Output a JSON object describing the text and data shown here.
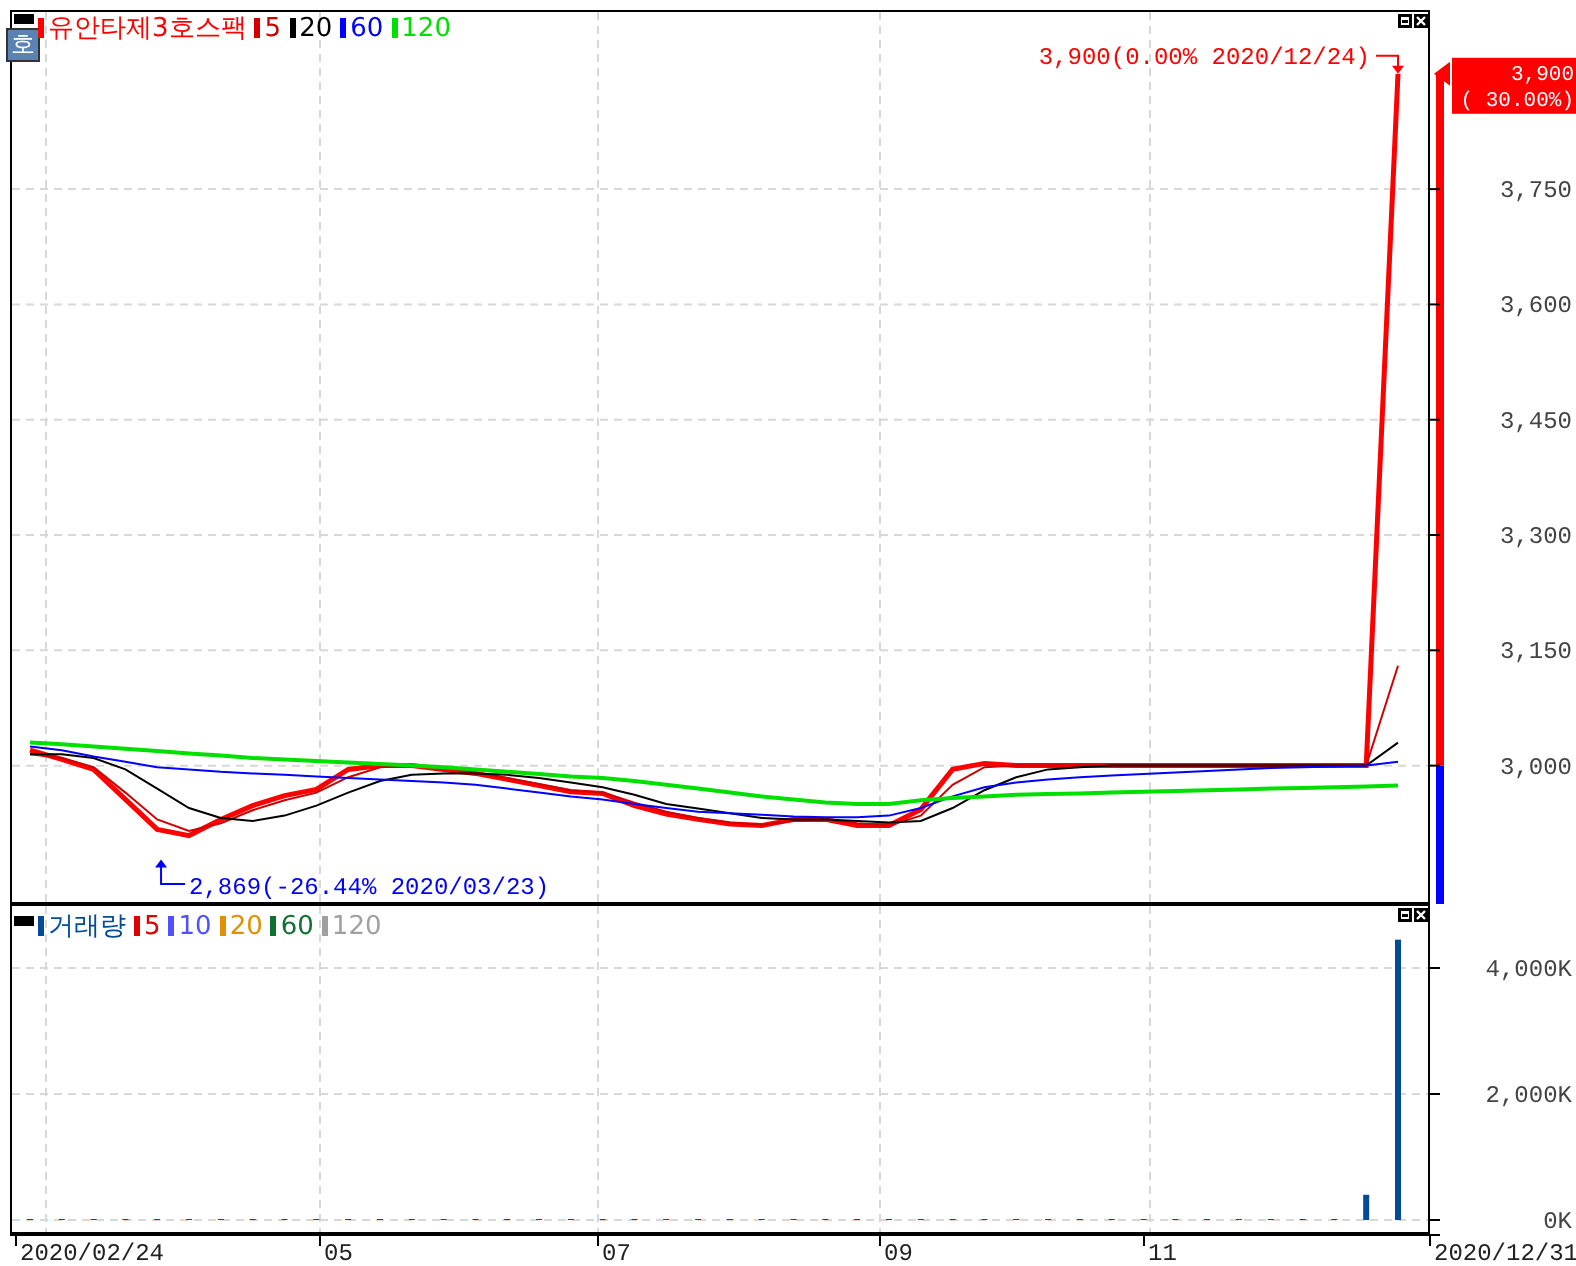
{
  "price_panel": {
    "badge": "호",
    "high_annotation": "3,900(0.00% 2020/12/24)",
    "low_annotation": "2,869(-26.44% 2020/03/23)",
    "current_price": {
      "price": "3,900",
      "change": "( 30.00%)"
    },
    "chart_data": {
      "type": "line",
      "categories": [
        null,
        null,
        null,
        null,
        null,
        null,
        null,
        null,
        null,
        null,
        null,
        null,
        null,
        null,
        null,
        null,
        null,
        null,
        null,
        null,
        null,
        null,
        null,
        null,
        null,
        null,
        null,
        null,
        null,
        null,
        null,
        null,
        null,
        null,
        null,
        null,
        null,
        null,
        null,
        null,
        null,
        null,
        null,
        null
      ],
      "ylim": [
        2820,
        3983
      ],
      "grid": true,
      "legend": "top-left",
      "yticks": [
        {
          "value": 3000,
          "label": "3,000"
        },
        {
          "value": 3150,
          "label": "3,150"
        },
        {
          "value": 3300,
          "label": "3,300"
        },
        {
          "value": 3450,
          "label": "3,450"
        },
        {
          "value": 3600,
          "label": "3,600"
        },
        {
          "value": 3750,
          "label": "3,750"
        }
      ],
      "series": [
        {
          "name": "유안타제3호스팩",
          "color": "#ff0000",
          "values": [
            3020,
            3008,
            2995,
            2956,
            2917,
            2909,
            2930,
            2948,
            2961,
            2969,
            2995,
            3000,
            3000,
            2995,
            2990,
            2982,
            2974,
            2966,
            2964,
            2948,
            2937,
            2930,
            2924,
            2922,
            2930,
            2930,
            2922,
            2922,
            2943,
            2995,
            3003,
            3000,
            3000,
            3000,
            3000,
            3000,
            3000,
            3000,
            3000,
            3000,
            3000,
            3000,
            3000,
            3900
          ]
        },
        {
          "name": "5",
          "color": "#d00000",
          "values": [
            3015,
            3010,
            2998,
            2965,
            2930,
            2915,
            2925,
            2942,
            2955,
            2965,
            2985,
            2998,
            3000,
            2997,
            2991,
            2984,
            2976,
            2968,
            2965,
            2952,
            2940,
            2932,
            2926,
            2923,
            2928,
            2930,
            2925,
            2922,
            2935,
            2975,
            2998,
            3000,
            3000,
            3000,
            3000,
            3000,
            3000,
            3000,
            3000,
            3000,
            3000,
            3000,
            3000,
            3130
          ]
        },
        {
          "name": "20",
          "color": "#000000",
          "values": [
            3015,
            3015,
            3010,
            2995,
            2970,
            2945,
            2932,
            2928,
            2935,
            2948,
            2965,
            2980,
            2988,
            2990,
            2990,
            2988,
            2984,
            2978,
            2972,
            2962,
            2950,
            2944,
            2938,
            2932,
            2930,
            2930,
            2928,
            2926,
            2928,
            2945,
            2968,
            2985,
            2995,
            2998,
            3000,
            3000,
            3000,
            3000,
            3000,
            3000,
            3000,
            3000,
            3000,
            3030
          ]
        },
        {
          "name": "60",
          "color": "#0000ff",
          "values": [
            3025,
            3020,
            3012,
            3005,
            2998,
            2995,
            2992,
            2990,
            2988,
            2986,
            2984,
            2982,
            2980,
            2978,
            2975,
            2970,
            2965,
            2960,
            2956,
            2950,
            2945,
            2940,
            2938,
            2936,
            2934,
            2933,
            2933,
            2935,
            2945,
            2960,
            2972,
            2978,
            2982,
            2985,
            2987,
            2989,
            2991,
            2993,
            2995,
            2997,
            2998,
            2999,
            3000,
            3005
          ]
        },
        {
          "name": "120",
          "color": "#00e000",
          "values": [
            3030,
            3028,
            3025,
            3022,
            3019,
            3016,
            3013,
            3010,
            3008,
            3006,
            3004,
            3002,
            3000,
            2998,
            2995,
            2992,
            2989,
            2986,
            2984,
            2980,
            2975,
            2970,
            2965,
            2960,
            2956,
            2952,
            2950,
            2950,
            2955,
            2958,
            2960,
            2962,
            2963,
            2964,
            2965,
            2966,
            2967,
            2968,
            2969,
            2970,
            2971,
            2972,
            2973,
            2974
          ]
        }
      ]
    }
  },
  "volume_panel": {
    "averages": [
      {
        "label": "5",
        "color": "#e00000"
      },
      {
        "label": "10",
        "color": "#5050ff"
      },
      {
        "label": "20",
        "color": "#e09000"
      },
      {
        "label": "60",
        "color": "#107030"
      },
      {
        "label": "120",
        "color": "#a0a0a0"
      }
    ],
    "chart_data": {
      "type": "bar",
      "categories": [
        null,
        null,
        null,
        null,
        null,
        null,
        null,
        null,
        null,
        null,
        null,
        null,
        null,
        null,
        null,
        null,
        null,
        null,
        null,
        null,
        null,
        null,
        null,
        null,
        null,
        null,
        null,
        null,
        null,
        null,
        null,
        null,
        null,
        null,
        null,
        null,
        null,
        null,
        null,
        null,
        null,
        null,
        null,
        null
      ],
      "ylim": [
        0,
        5016
      ],
      "grid": true,
      "legend": "top-left",
      "yticks": [
        {
          "value": 0,
          "label": "0K"
        },
        {
          "value": 2000,
          "label": "2,000K"
        },
        {
          "value": 4000,
          "label": "4,000K"
        }
      ],
      "series": [
        {
          "name": "거래량",
          "color": "#004c99",
          "values": [
            0,
            0,
            0,
            0,
            0,
            0,
            0,
            0,
            0,
            0,
            0,
            0,
            0,
            0,
            0,
            0,
            0,
            0,
            0,
            0,
            0,
            0,
            0,
            0,
            0,
            0,
            0,
            0,
            0,
            0,
            0,
            0,
            0,
            0,
            0,
            0,
            0,
            0,
            0,
            0,
            0,
            0,
            400,
            4450
          ]
        }
      ]
    }
  },
  "x_axis": [
    "2020/02/24",
    "05",
    "07",
    "09",
    "11",
    "2020/12/31"
  ]
}
